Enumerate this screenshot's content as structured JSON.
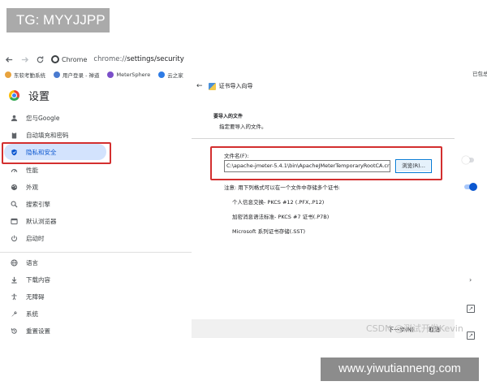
{
  "tg_badge": "TG: MYYJJPP",
  "toolbar": {
    "chrome_label": "Chrome",
    "url_scheme": "chrome://",
    "url_path": "settings/security"
  },
  "bookmarks": [
    {
      "label": "东软考勤系统",
      "color": "#e8a33d"
    },
    {
      "label": "用户登录 - 禅道",
      "color": "#4a7bd0"
    },
    {
      "label": "MeterSphere",
      "color": "#7b4fc9"
    },
    {
      "label": "云之家",
      "color": "#2d7be5"
    }
  ],
  "bookmark_right": "已包总结 - zjyf",
  "settings": {
    "title": "设置",
    "sidebar": [
      {
        "label": "您与Google",
        "icon": "person-icon"
      },
      {
        "label": "自动填充和密码",
        "icon": "clipboard-icon"
      },
      {
        "label": "隐私和安全",
        "icon": "shield-icon"
      },
      {
        "label": "性能",
        "icon": "speedometer-icon"
      },
      {
        "label": "外观",
        "icon": "palette-icon"
      },
      {
        "label": "搜索引擎",
        "icon": "search-icon"
      },
      {
        "label": "默认浏览器",
        "icon": "browser-icon"
      },
      {
        "label": "启动时",
        "icon": "power-icon"
      },
      {
        "label": "语言",
        "icon": "globe-icon"
      },
      {
        "label": "下载内容",
        "icon": "download-icon"
      },
      {
        "label": "无障碍",
        "icon": "accessibility-icon"
      },
      {
        "label": "系统",
        "icon": "wrench-icon"
      },
      {
        "label": "重置设置",
        "icon": "reset-icon"
      }
    ],
    "active_index": 2
  },
  "wizard": {
    "title": "证书导入向导",
    "section_title": "要导入的文件",
    "section_subtitle": "指定要导入的文件。",
    "file_label": "文件名(F):",
    "file_value": "C:\\apache-jmeter-5.4.1\\bin\\ApacheJMeterTemporaryRootCA.crt",
    "browse_label": "浏览(R)...",
    "note": "注意: 用下列格式可以在一个文件中存储多个证书:",
    "formats": [
      "个人信息交换- PKCS #12 (.PFX,.P12)",
      "加密消息语法标准- PKCS #7 证书(.P7B)",
      "Microsoft 系列证书存储(.SST)"
    ],
    "next_label": "下一步(N)",
    "cancel_label": "取消"
  },
  "watermark_csdn": "CSDN @测试开发Kevin",
  "watermark_site": "www.yiwutianneng.com",
  "colors": {
    "accent": "#0b57d0",
    "active_bg": "#d3e3fd",
    "highlight_red": "#d32f2f"
  }
}
